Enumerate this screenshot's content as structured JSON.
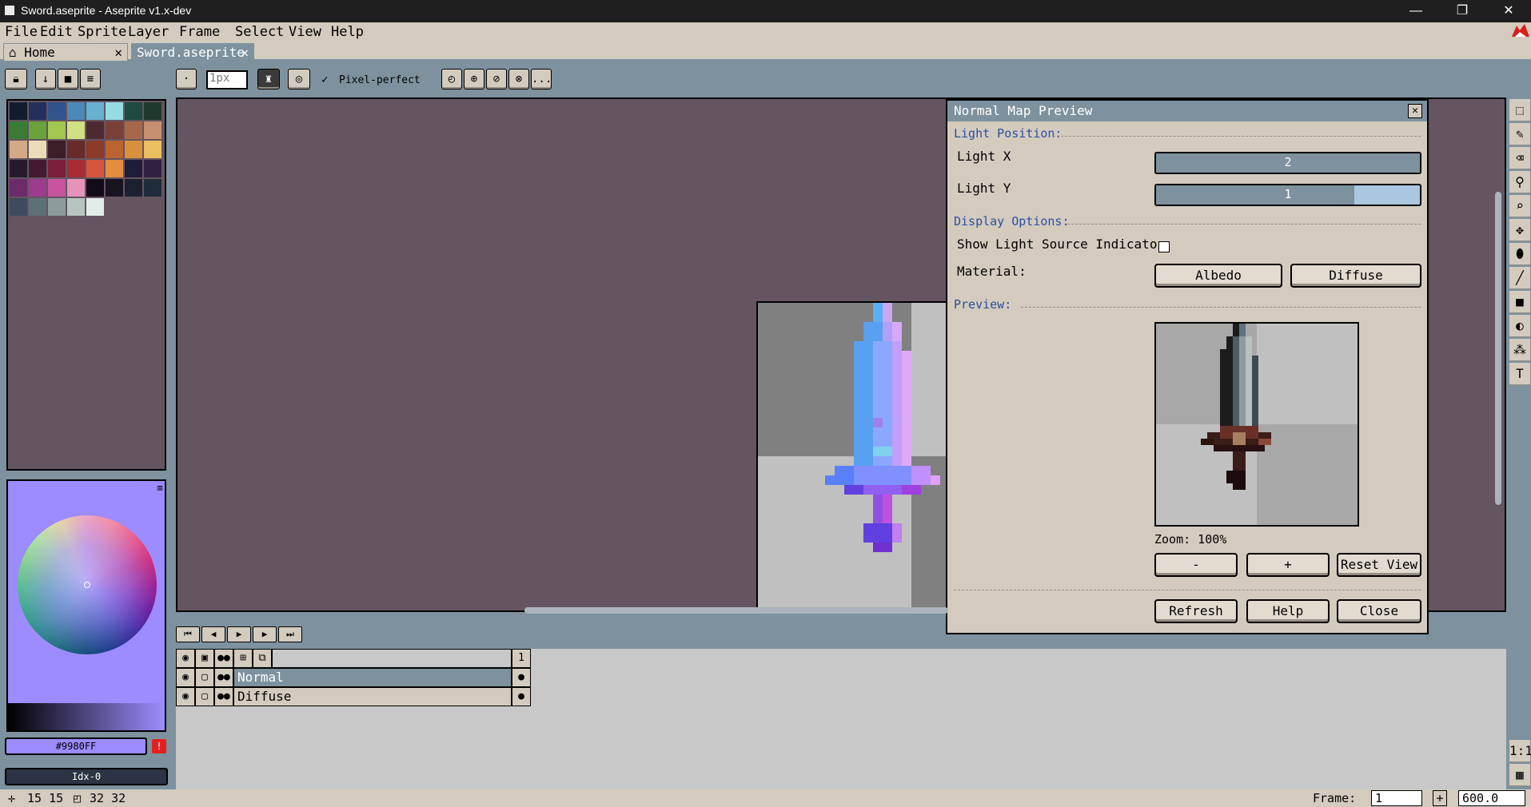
{
  "window": {
    "title": "Sword.aseprite - Aseprite v1.x-dev",
    "minimize": "—",
    "maximize": "❐",
    "close": "✕"
  },
  "menu": [
    "File",
    "Edit",
    "Sprite",
    "Layer",
    "Frame",
    "Select",
    "View",
    "Help"
  ],
  "tabs": [
    {
      "label": "Home",
      "icon": "home-icon",
      "close": "✕"
    },
    {
      "label": "Sword.aseprite",
      "close": "✕",
      "active": true
    }
  ],
  "toolbar": {
    "brush_size": "1px",
    "pixel_perfect_label": "Pixel-perfect",
    "more": "..."
  },
  "palette": {
    "colors": [
      "#131c2c",
      "#24305c",
      "#31528c",
      "#4c88b8",
      "#66b0d0",
      "#94dce0",
      "#1e4a40",
      "#1f3a2c",
      "#3a7c36",
      "#6aa23c",
      "#a2c850",
      "#d2e084",
      "#4c2a30",
      "#7a4038",
      "#a86848",
      "#c89070",
      "#d4aa86",
      "#ecdcb8",
      "#3c1e28",
      "#6a2a2c",
      "#8c3a2a",
      "#bc6430",
      "#d8903c",
      "#ecc060",
      "#281a2c",
      "#441a30",
      "#7a2038",
      "#a82c34",
      "#d4563c",
      "#e48c40",
      "#201c3c",
      "#302040",
      "#6c2a6c",
      "#9c3c8c",
      "#c854a0",
      "#e494b8",
      "#120c18",
      "#181420",
      "#1c2030",
      "#1e2c3c",
      "#3c4c5c",
      "#5c7078",
      "#8c9c9c",
      "#b8c4c0",
      "#e4ece8"
    ]
  },
  "color": {
    "hex": "#9980FF",
    "index": "Idx-0",
    "warn": "!"
  },
  "status": {
    "pos": "15 15",
    "size": "32 32",
    "frame_label": "Frame:",
    "frame_value": "1",
    "zoom": "600.0"
  },
  "dialog": {
    "title": "Normal Map Preview",
    "light_position": "Light Position:",
    "light_x_label": "Light X",
    "light_x_value": 2,
    "light_x_fill": 1.0,
    "light_y_label": "Light Y",
    "light_y_value": 1,
    "light_y_fill": 0.75,
    "display_options": "Display Options:",
    "show_indicator": "Show Light Source Indicator",
    "show_indicator_checked": false,
    "material_label": "Material:",
    "albedo": "Albedo",
    "diffuse": "Diffuse",
    "preview": "Preview:",
    "zoom": "Zoom: 100%",
    "zoom_out": "-",
    "zoom_in": "+",
    "reset_view": "Reset View",
    "refresh": "Refresh",
    "help": "Help",
    "close": "Close"
  },
  "timeline": {
    "frame_number": "1",
    "layers": [
      {
        "name": "Normal",
        "selected": true
      },
      {
        "name": "Diffuse",
        "selected": false
      }
    ]
  },
  "tools": [
    "marquee-icon",
    "pencil-icon",
    "eraser-icon",
    "eyedropper-icon",
    "zoom-icon",
    "move-icon",
    "fill-icon",
    "line-icon",
    "rectangle-icon",
    "blur-icon",
    "spray-icon",
    "text-icon"
  ]
}
